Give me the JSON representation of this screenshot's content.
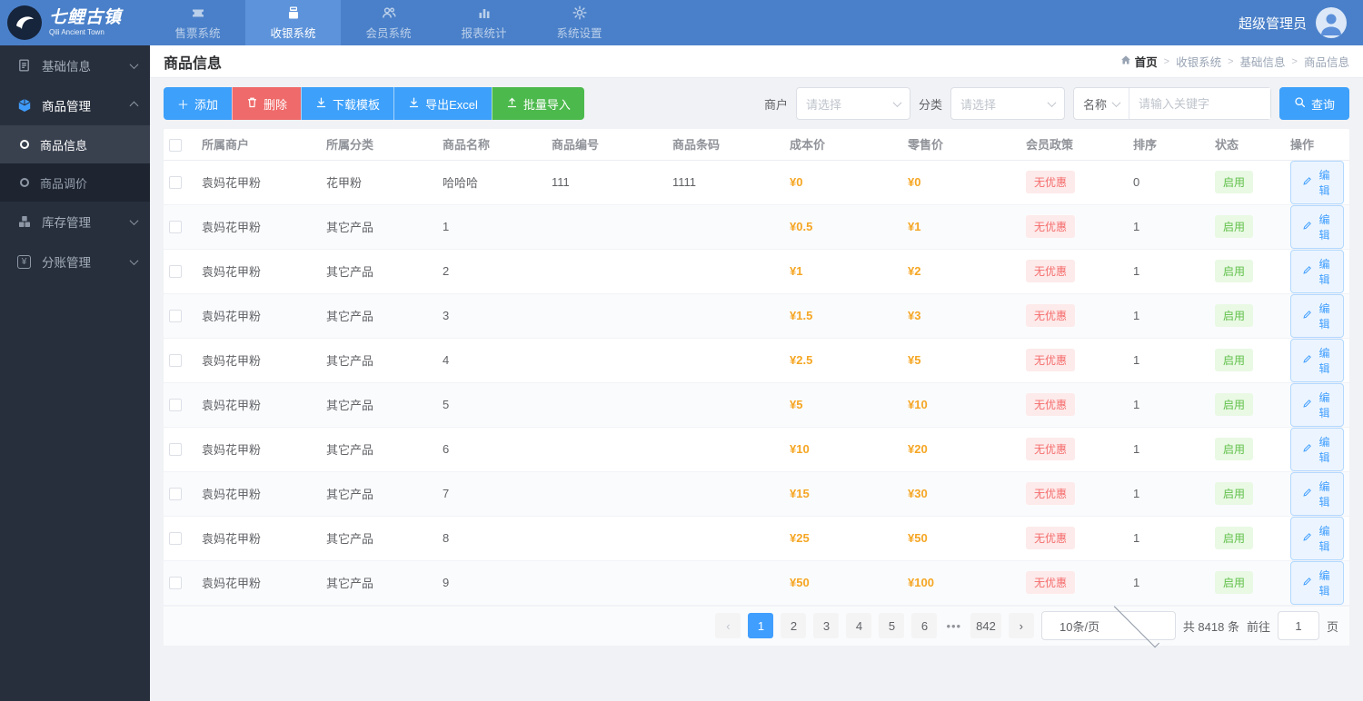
{
  "topbar": {
    "logo_title": "七鲤古镇",
    "logo_subtitle": "Qili Ancient Town",
    "nav": [
      {
        "label": "售票系统",
        "icon": "ticket-icon",
        "active": false
      },
      {
        "label": "收银系统",
        "icon": "cashier-icon",
        "active": true
      },
      {
        "label": "会员系统",
        "icon": "members-icon",
        "active": false
      },
      {
        "label": "报表统计",
        "icon": "report-icon",
        "active": false
      },
      {
        "label": "系统设置",
        "icon": "gear-icon",
        "active": false
      }
    ],
    "user_name": "超级管理员"
  },
  "sidebar": {
    "items": [
      {
        "label": "基础信息",
        "icon": "document-icon",
        "state": "collapsed"
      },
      {
        "label": "商品管理",
        "icon": "cube-icon",
        "state": "expanded"
      },
      {
        "label": "库存管理",
        "icon": "inventory-icon",
        "state": "collapsed"
      },
      {
        "label": "分账管理",
        "icon": "ledger-icon",
        "state": "collapsed"
      }
    ],
    "submenu": [
      {
        "label": "商品信息",
        "active": true
      },
      {
        "label": "商品调价",
        "active": false
      }
    ]
  },
  "page": {
    "title": "商品信息",
    "breadcrumb": [
      "首页",
      "收银系统",
      "基础信息",
      "商品信息"
    ]
  },
  "toolbar": {
    "add_label": "添加",
    "delete_label": "删除",
    "download_template_label": "下载模板",
    "export_excel_label": "导出Excel",
    "batch_import_label": "批量导入"
  },
  "filters": {
    "merchant_label": "商户",
    "merchant_placeholder": "请选择",
    "category_label": "分类",
    "category_placeholder": "请选择",
    "name_field_label": "名称",
    "keyword_placeholder": "请输入关键字",
    "search_label": "查询"
  },
  "table": {
    "columns": [
      "所属商户",
      "所属分类",
      "商品名称",
      "商品编号",
      "商品条码",
      "成本价",
      "零售价",
      "会员政策",
      "排序",
      "状态",
      "操作"
    ],
    "rows": [
      {
        "merchant": "袁妈花甲粉",
        "category": "花甲粉",
        "name": "哈哈哈",
        "code": "111",
        "barcode": "1111",
        "cost": "¥0",
        "retail": "¥0",
        "policy": "无优惠",
        "sort": "0",
        "status": "启用",
        "action": "编辑"
      },
      {
        "merchant": "袁妈花甲粉",
        "category": "其它产品",
        "name": "1",
        "code": "",
        "barcode": "",
        "cost": "¥0.5",
        "retail": "¥1",
        "policy": "无优惠",
        "sort": "1",
        "status": "启用",
        "action": "编辑"
      },
      {
        "merchant": "袁妈花甲粉",
        "category": "其它产品",
        "name": "2",
        "code": "",
        "barcode": "",
        "cost": "¥1",
        "retail": "¥2",
        "policy": "无优惠",
        "sort": "1",
        "status": "启用",
        "action": "编辑"
      },
      {
        "merchant": "袁妈花甲粉",
        "category": "其它产品",
        "name": "3",
        "code": "",
        "barcode": "",
        "cost": "¥1.5",
        "retail": "¥3",
        "policy": "无优惠",
        "sort": "1",
        "status": "启用",
        "action": "编辑"
      },
      {
        "merchant": "袁妈花甲粉",
        "category": "其它产品",
        "name": "4",
        "code": "",
        "barcode": "",
        "cost": "¥2.5",
        "retail": "¥5",
        "policy": "无优惠",
        "sort": "1",
        "status": "启用",
        "action": "编辑"
      },
      {
        "merchant": "袁妈花甲粉",
        "category": "其它产品",
        "name": "5",
        "code": "",
        "barcode": "",
        "cost": "¥5",
        "retail": "¥10",
        "policy": "无优惠",
        "sort": "1",
        "status": "启用",
        "action": "编辑"
      },
      {
        "merchant": "袁妈花甲粉",
        "category": "其它产品",
        "name": "6",
        "code": "",
        "barcode": "",
        "cost": "¥10",
        "retail": "¥20",
        "policy": "无优惠",
        "sort": "1",
        "status": "启用",
        "action": "编辑"
      },
      {
        "merchant": "袁妈花甲粉",
        "category": "其它产品",
        "name": "7",
        "code": "",
        "barcode": "",
        "cost": "¥15",
        "retail": "¥30",
        "policy": "无优惠",
        "sort": "1",
        "status": "启用",
        "action": "编辑"
      },
      {
        "merchant": "袁妈花甲粉",
        "category": "其它产品",
        "name": "8",
        "code": "",
        "barcode": "",
        "cost": "¥25",
        "retail": "¥50",
        "policy": "无优惠",
        "sort": "1",
        "status": "启用",
        "action": "编辑"
      },
      {
        "merchant": "袁妈花甲粉",
        "category": "其它产品",
        "name": "9",
        "code": "",
        "barcode": "",
        "cost": "¥50",
        "retail": "¥100",
        "policy": "无优惠",
        "sort": "1",
        "status": "启用",
        "action": "编辑"
      }
    ]
  },
  "pagination": {
    "pages": [
      "1",
      "2",
      "3",
      "4",
      "5",
      "6",
      "...",
      "842"
    ],
    "active_page": "1",
    "page_size": "10条/页",
    "total_text": "共 8418 条",
    "goto_prefix": "前往",
    "goto_value": "1",
    "goto_suffix": "页"
  },
  "colors": {
    "topbar": "#4a80c9",
    "topbar_active": "#5d93da",
    "sidebar": "#272f3c",
    "primary": "#3da0fa",
    "danger": "#ef6a6a",
    "success": "#4cb94c",
    "price": "#f5a623"
  }
}
